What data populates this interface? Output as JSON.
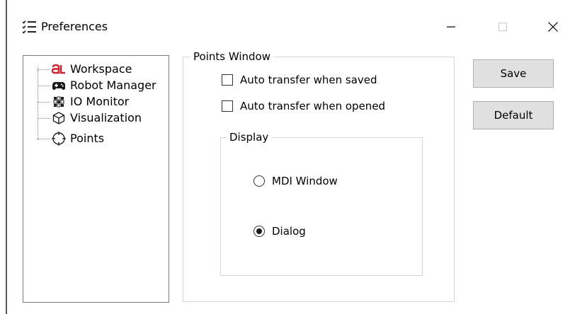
{
  "window": {
    "title": "Preferences",
    "icon": "list-settings-icon",
    "controls": [
      "minimize-icon",
      "maximize-icon",
      "close-icon"
    ]
  },
  "tree": {
    "items": [
      {
        "label": "Workspace",
        "icon": "workspace-logo-icon",
        "color": "#d0202a"
      },
      {
        "label": "Robot Manager",
        "icon": "gamepad-icon"
      },
      {
        "label": "IO Monitor",
        "icon": "io-grid-icon"
      },
      {
        "label": "Visualization",
        "icon": "cube-icon"
      },
      {
        "label": "Points",
        "icon": "crosshair-icon",
        "selected": true
      }
    ]
  },
  "points_window": {
    "title": "Points Window",
    "auto_transfer_saved": {
      "label": "Auto transfer when saved",
      "checked": false
    },
    "auto_transfer_opened": {
      "label": "Auto transfer when opened",
      "checked": false
    },
    "display": {
      "title": "Display",
      "options": [
        {
          "label": "MDI Window",
          "selected": false
        },
        {
          "label": "Dialog",
          "selected": true
        }
      ]
    }
  },
  "buttons": {
    "save_label": "Save",
    "default_label": "Default"
  }
}
